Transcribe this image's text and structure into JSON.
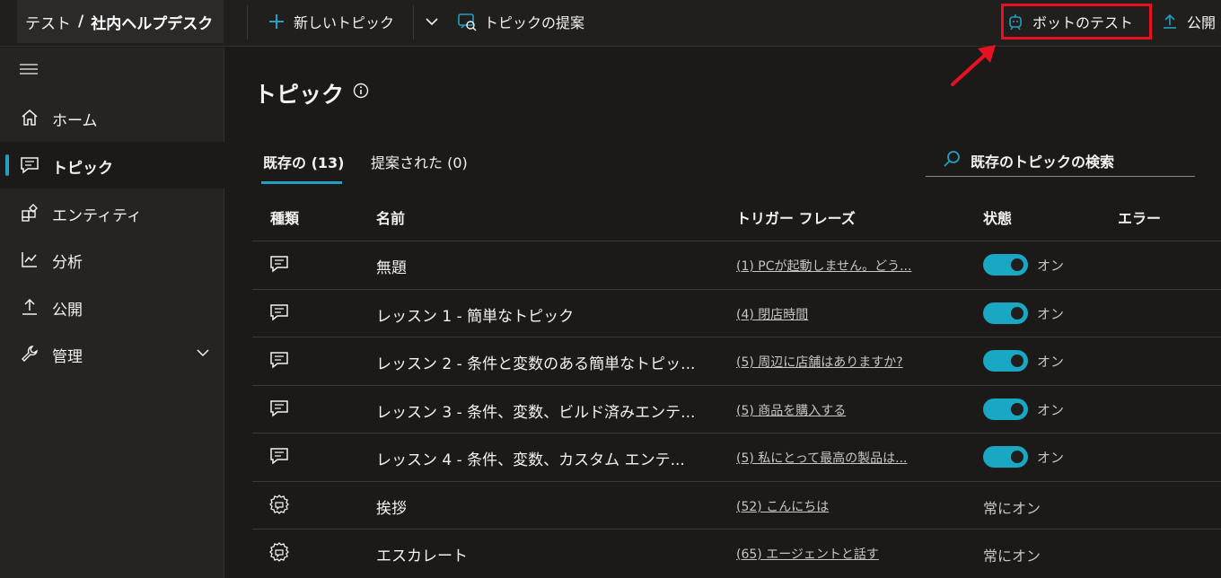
{
  "breadcrumb": {
    "env": "テスト",
    "separator": "/",
    "bot": "社内ヘルプデスク"
  },
  "toolbar": {
    "new_topic": "新しいトピック",
    "suggest_topics": "トピックの提案",
    "test_bot": "ボットのテスト",
    "publish": "公開"
  },
  "sidebar": {
    "items": [
      {
        "label": "ホーム",
        "icon": "home-icon"
      },
      {
        "label": "トピック",
        "icon": "chat-icon",
        "active": true
      },
      {
        "label": "エンティティ",
        "icon": "entity-icon"
      },
      {
        "label": "分析",
        "icon": "analytics-icon"
      },
      {
        "label": "公開",
        "icon": "publish-icon"
      },
      {
        "label": "管理",
        "icon": "wrench-icon"
      }
    ]
  },
  "page": {
    "title": "トピック"
  },
  "tabs": [
    {
      "label": "既存の (13)",
      "active": true
    },
    {
      "label": "提案された (0)"
    }
  ],
  "search": {
    "placeholder": "既存のトピックの検索"
  },
  "table": {
    "headers": {
      "type": "種類",
      "name": "名前",
      "trigger": "トリガー フレーズ",
      "status": "状態",
      "error": "エラー"
    },
    "rows": [
      {
        "type": "user",
        "name": "無題",
        "trigger": "(1) PCが起動しません。どう...",
        "status": "on",
        "status_label": "オン"
      },
      {
        "type": "user",
        "name": "レッスン 1 - 簡単なトピック",
        "trigger": "(4) 閉店時間",
        "status": "on",
        "status_label": "オン"
      },
      {
        "type": "user",
        "name": "レッスン 2 - 条件と変数のある簡単なトピッ...",
        "trigger": "(5) 周辺に店舗はありますか?",
        "status": "on",
        "status_label": "オン"
      },
      {
        "type": "user",
        "name": "レッスン 3 - 条件、変数、ビルド済みエンテ...",
        "trigger": "(5) 商品を購入する",
        "status": "on",
        "status_label": "オン"
      },
      {
        "type": "user",
        "name": "レッスン 4 - 条件、変数、カスタム エンテ...",
        "trigger": "(5) 私にとって最高の製品は...",
        "status": "on",
        "status_label": "オン"
      },
      {
        "type": "system",
        "name": "挨拶",
        "trigger": "(52) こんにちは",
        "status": "always",
        "status_label": "常にオン"
      },
      {
        "type": "system",
        "name": "エスカレート",
        "trigger": "(65) エージェントと話す",
        "status": "always",
        "status_label": "常にオン"
      }
    ]
  },
  "colors": {
    "accent": "#21a0c0",
    "toggle": "#1aa7c4",
    "highlight": "#e81123",
    "background": "#1b1a19"
  }
}
